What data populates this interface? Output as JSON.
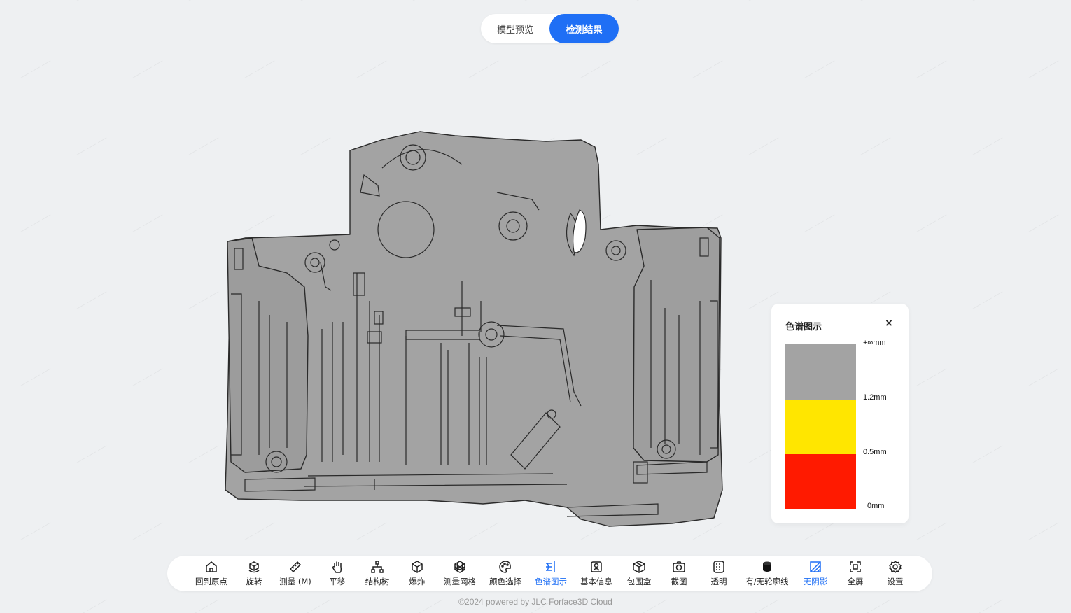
{
  "tabs": [
    {
      "label": "模型预览",
      "active": false
    },
    {
      "label": "检测结果",
      "active": true
    }
  ],
  "legend": {
    "title": "色谱图示",
    "close_glyph": "×",
    "ticks": [
      "+∞mm",
      "1.2mm",
      "0.5mm",
      "0mm"
    ],
    "colors": {
      "gray": "#a3a3a3",
      "yellow": "#ffe600",
      "red": "#ff1a00"
    }
  },
  "toolbar": [
    {
      "id": "home",
      "label": "回到原点",
      "icon": "home-icon",
      "active": false
    },
    {
      "id": "rotate",
      "label": "旋转",
      "icon": "rotate-cube-icon",
      "active": false
    },
    {
      "id": "measure",
      "label": "测量 (M)",
      "icon": "ruler-icon",
      "active": false
    },
    {
      "id": "pan",
      "label": "平移",
      "icon": "hand-icon",
      "active": false
    },
    {
      "id": "tree",
      "label": "结构树",
      "icon": "tree-icon",
      "active": false
    },
    {
      "id": "explode",
      "label": "爆炸",
      "icon": "explode-cube-icon",
      "active": false
    },
    {
      "id": "mesh",
      "label": "测量网格",
      "icon": "mesh-icon",
      "active": false
    },
    {
      "id": "color",
      "label": "颜色选择",
      "icon": "palette-icon",
      "active": false
    },
    {
      "id": "spectrum",
      "label": "色谱图示",
      "icon": "spectrum-icon",
      "active": true
    },
    {
      "id": "info",
      "label": "基本信息",
      "icon": "info-icon",
      "active": false
    },
    {
      "id": "bbox",
      "label": "包围盒",
      "icon": "bounding-box-icon",
      "active": false
    },
    {
      "id": "screenshot",
      "label": "截图",
      "icon": "camera-icon",
      "active": false
    },
    {
      "id": "transparent",
      "label": "透明",
      "icon": "transparent-icon",
      "active": false
    },
    {
      "id": "outline",
      "label": "有/无轮廓线",
      "icon": "cylinder-icon",
      "active": false
    },
    {
      "id": "shadow",
      "label": "无阴影",
      "icon": "shadow-icon",
      "active": true
    },
    {
      "id": "fullscreen",
      "label": "全屏",
      "icon": "fullscreen-icon",
      "active": false
    },
    {
      "id": "settings",
      "label": "设置",
      "icon": "gear-icon",
      "active": false
    }
  ],
  "footer": "©2024 powered by JLC Forface3D Cloud",
  "accent_color": "#1f6ff5"
}
